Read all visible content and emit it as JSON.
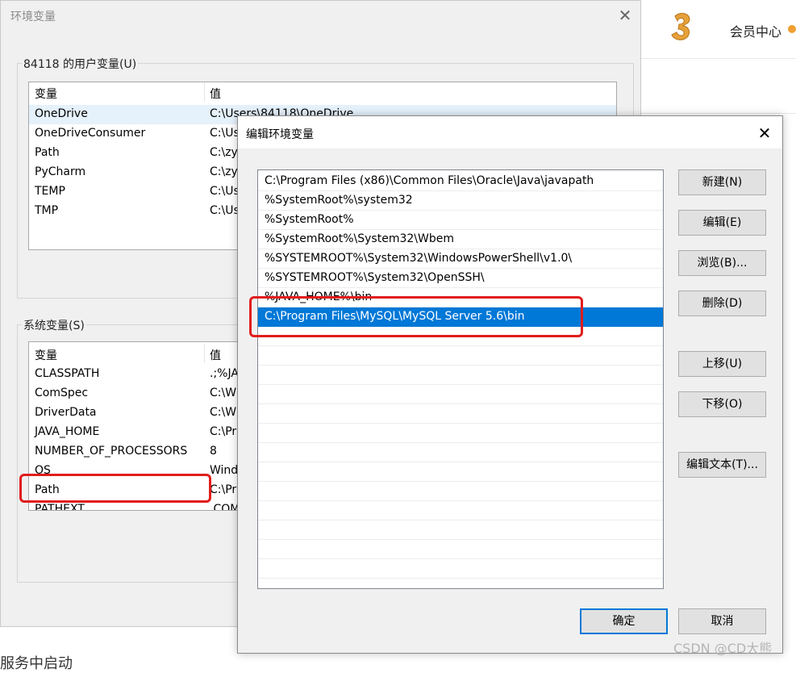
{
  "background_page": {
    "member_center": "会员中心",
    "bottom_text": "服务中启动"
  },
  "env_dialog": {
    "title": "环境变量",
    "close_icon": "close-icon",
    "user_group_label": "84118 的用户变量(U)",
    "system_group_label": "系统变量(S)",
    "columns": {
      "name": "变量",
      "value": "值"
    },
    "user_vars": [
      {
        "name": "OneDrive",
        "value": "C:\\Users\\84118\\OneDrive"
      },
      {
        "name": "OneDriveConsumer",
        "value": "C:\\Us"
      },
      {
        "name": "Path",
        "value": "C:\\zy"
      },
      {
        "name": "PyCharm",
        "value": "C:\\zy"
      },
      {
        "name": "TEMP",
        "value": "C:\\Us"
      },
      {
        "name": "TMP",
        "value": "C:\\Us"
      }
    ],
    "system_vars": [
      {
        "name": "CLASSPATH",
        "value": ".;%JA"
      },
      {
        "name": "ComSpec",
        "value": "C:\\W"
      },
      {
        "name": "DriverData",
        "value": "C:\\W"
      },
      {
        "name": "JAVA_HOME",
        "value": "C:\\Pr"
      },
      {
        "name": "NUMBER_OF_PROCESSORS",
        "value": "8"
      },
      {
        "name": "OS",
        "value": "Wind"
      },
      {
        "name": "Path",
        "value": "C:\\Pr"
      },
      {
        "name": "PATHEXT",
        "value": ".COM"
      }
    ]
  },
  "edit_dialog": {
    "title": "编辑环境变量",
    "close_icon": "close-icon",
    "paths": [
      "C:\\Program Files (x86)\\Common Files\\Oracle\\Java\\javapath",
      "%SystemRoot%\\system32",
      "%SystemRoot%",
      "%SystemRoot%\\System32\\Wbem",
      "%SYSTEMROOT%\\System32\\WindowsPowerShell\\v1.0\\",
      "%SYSTEMROOT%\\System32\\OpenSSH\\",
      "%JAVA_HOME%\\bin",
      "C:\\Program Files\\MySQL\\MySQL Server 5.6\\bin"
    ],
    "selected_path_index": 7,
    "buttons": {
      "new": "新建(N)",
      "edit": "编辑(E)",
      "browse": "浏览(B)...",
      "delete": "删除(D)",
      "move_up": "上移(U)",
      "move_down": "下移(O)",
      "edit_text": "编辑文本(T)...",
      "ok": "确定",
      "cancel": "取消"
    }
  },
  "watermark": "CSDN @CD大熊",
  "colors": {
    "selection": "#0078d7",
    "annotation": "#e11d1d"
  }
}
